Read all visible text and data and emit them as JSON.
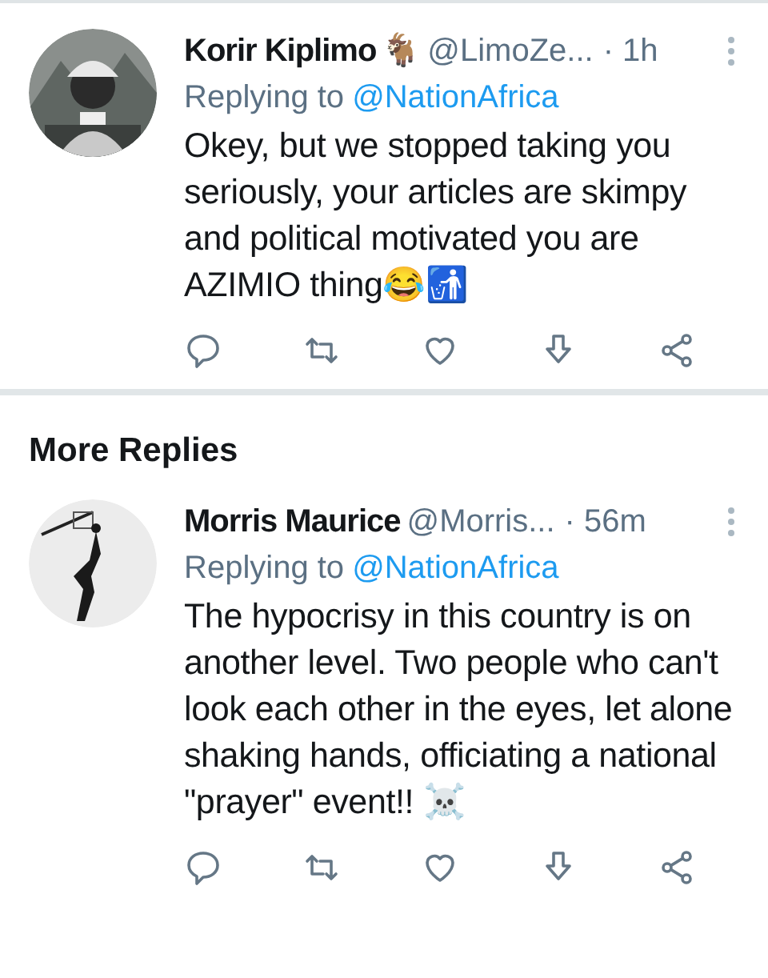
{
  "tweets": [
    {
      "name": "Korir Kiplimo",
      "name_emoji": "🐐",
      "handle": "@LimoZe...",
      "time": "· 1h",
      "replying_label": "Replying to",
      "replying_to": "@NationAfrica",
      "text": "Okey, but we stopped taking you seriously, your articles are skimpy and political motivated you are AZIMIO thing😂🚮"
    },
    {
      "name": "Morris Maurice",
      "handle": "@Morris...",
      "time": "· 56m",
      "replying_label": "Replying to",
      "replying_to": "@NationAfrica",
      "text": "The hypocrisy in this country is on another level. Two people who can't look each other in the eyes, let alone shaking hands, officiating a national \"prayer\" event!! ☠️"
    }
  ],
  "section_title": "More Replies"
}
